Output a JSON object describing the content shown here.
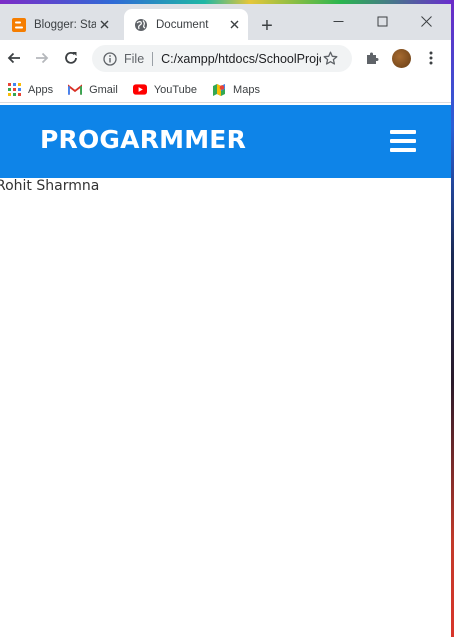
{
  "browser": {
    "tabs": [
      {
        "title": "Blogger: Stats",
        "active": false,
        "icon": "blogger-icon"
      },
      {
        "title": "Document",
        "active": true,
        "icon": "globe-icon"
      }
    ],
    "new_tab_label": "+",
    "address": {
      "scheme_label": "File",
      "url": "C:/xampp/htdocs/SchoolProject/index.html"
    },
    "bookmarks": [
      {
        "label": "Apps",
        "icon": "apps-grid-icon"
      },
      {
        "label": "Gmail",
        "icon": "gmail-icon"
      },
      {
        "label": "YouTube",
        "icon": "youtube-icon"
      },
      {
        "label": "Maps",
        "icon": "maps-icon"
      }
    ]
  },
  "page": {
    "brand": "PROGARMMER",
    "menu_icon": "hamburger-menu-icon",
    "body_text": "Rohit Sharmna"
  },
  "colors": {
    "header_bg": "#0e84e8",
    "tab_strip_bg": "#dee1e6",
    "brand_text": "#ffffff"
  }
}
